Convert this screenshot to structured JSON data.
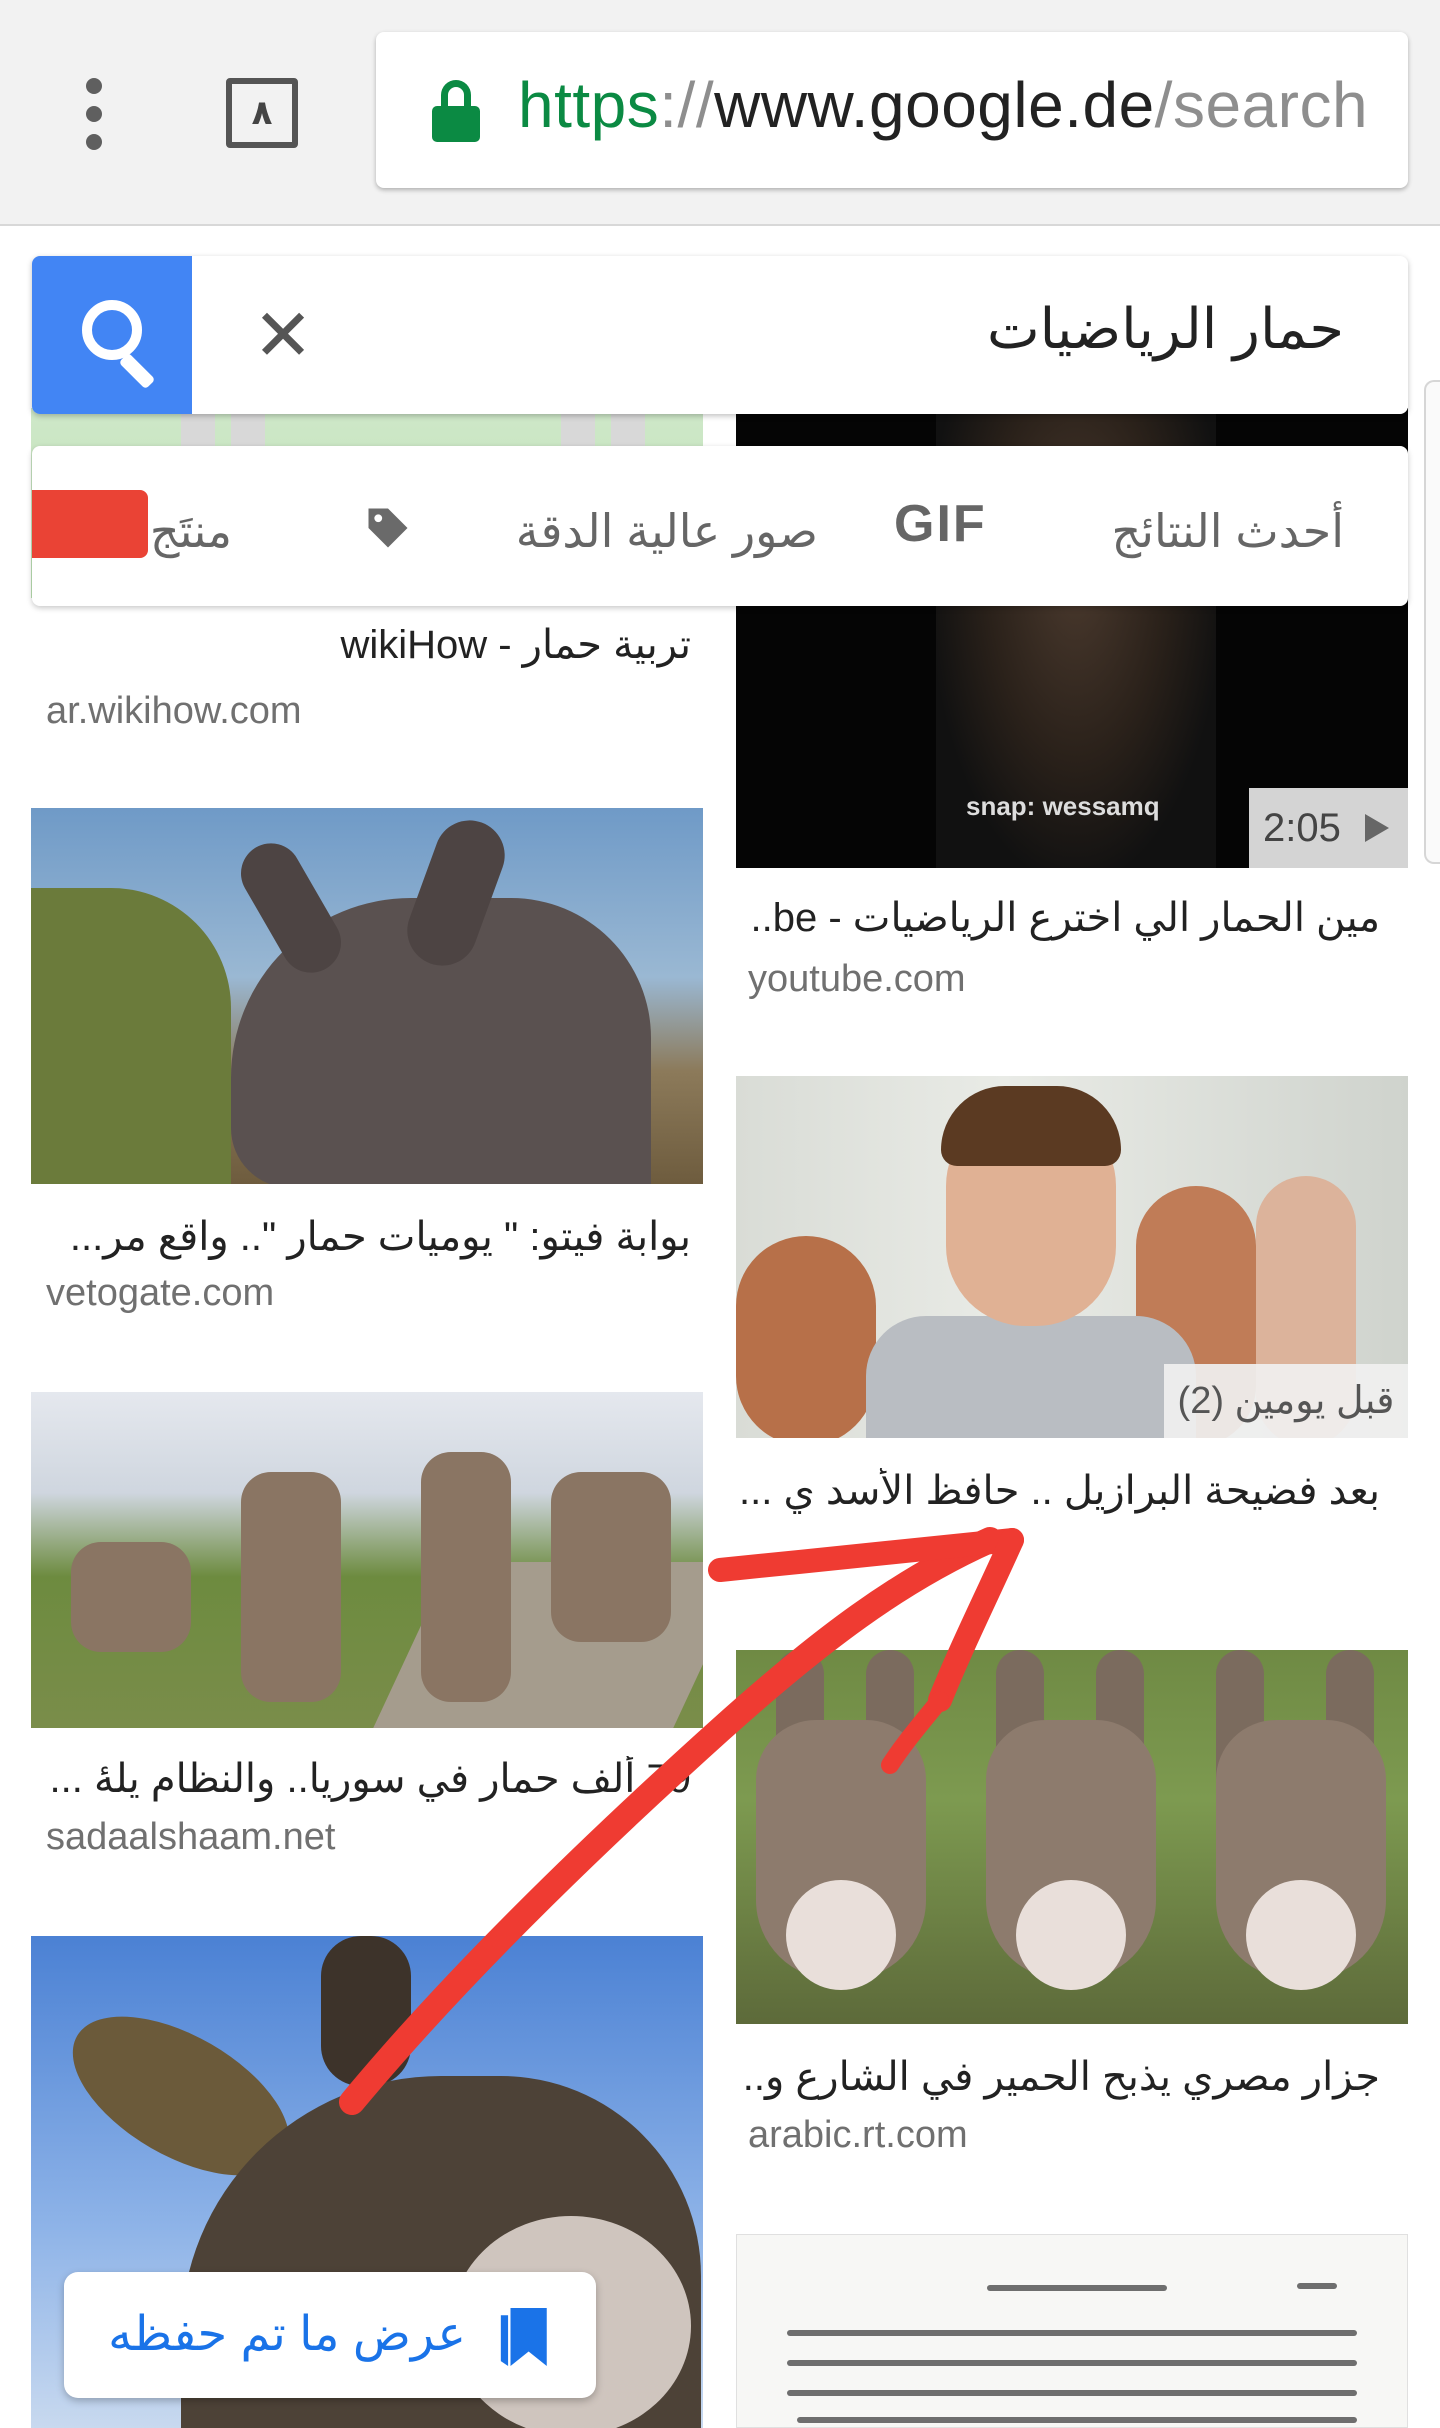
{
  "browser": {
    "tab_count": "٨",
    "url": {
      "scheme": "https",
      "separator": "://",
      "host": "www.google.de",
      "path": "/search"
    }
  },
  "search": {
    "query": "حمار الرياضيات",
    "clear_symbol": "✕"
  },
  "filters": {
    "chips": [
      "أحدث النتائج",
      "GIF",
      "صور عالية الدقة",
      "منتَج"
    ],
    "color_chip": "#ea4335"
  },
  "results": [
    {
      "title": "تربية حمار - wikiHow",
      "source": "ar.wikihow.com"
    },
    {
      "title": "مين الحمار الي اخترع الرياضيات - be..",
      "source": "youtube.com",
      "duration": "2:05",
      "overlay_text": "snap: wessamq"
    },
    {
      "title": "بوابة فيتو: \" يوميات حمار \".. واقع مر...",
      "source": "vetogate.com"
    },
    {
      "title": "بعد فضيحة البرازيل .. حافظ الأسد ي ...",
      "badge": "قبل يومين (2)"
    },
    {
      "title": "79 ألف حمار في سوريا.. والنظام يلهٔ ...",
      "source": "sadaalshaam.net"
    },
    {
      "title": "جزار مصري يذبح الحمير في الشارع و...",
      "source": "arabic.rt.com"
    }
  ],
  "saved": {
    "label": "عرض ما تم حفظه"
  },
  "colors": {
    "accent": "#4285f4",
    "secure_green": "#0b8a43",
    "annotation_red": "#ef3b32",
    "saved_blue": "#1a73e8"
  }
}
